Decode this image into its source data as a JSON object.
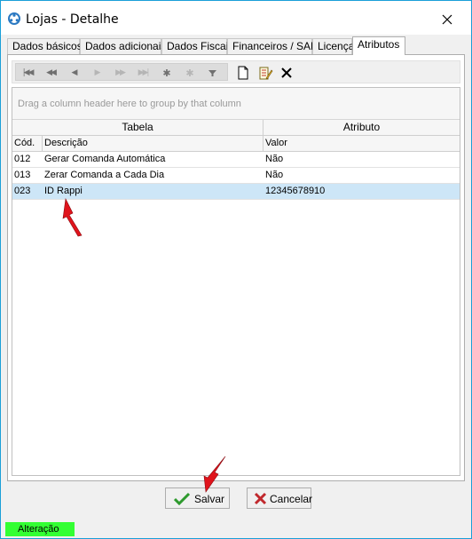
{
  "window": {
    "title": "Lojas - Detalhe"
  },
  "tabs": [
    {
      "label": "Dados básicos"
    },
    {
      "label": "Dados adicionais"
    },
    {
      "label": "Dados Fiscais"
    },
    {
      "label": "Financeiros / SAP"
    },
    {
      "label": "Licença"
    },
    {
      "label": "Atributos",
      "active": true
    }
  ],
  "toolbar": {
    "nav_buttons": [
      "first",
      "prior-page",
      "prior",
      "next",
      "next-page",
      "last",
      "insert",
      "delete",
      "filter"
    ],
    "extra_buttons": [
      "new-document-icon",
      "edit-document-icon",
      "delete-x-icon"
    ]
  },
  "grid": {
    "group_hint": "Drag a column header here to group by that column",
    "bands": [
      "Tabela",
      "Atributo"
    ],
    "columns": [
      "Cód.",
      "Descrição",
      "Valor"
    ],
    "rows": [
      {
        "cod": "012",
        "descricao": "Gerar Comanda Automática",
        "valor": "Não"
      },
      {
        "cod": "013",
        "descricao": "Zerar Comanda a Cada Dia",
        "valor": "Não"
      },
      {
        "cod": "023",
        "descricao": "ID Rappi",
        "valor": "12345678910",
        "selected": true
      }
    ]
  },
  "buttons": {
    "save_label": "Salvar",
    "cancel_label": "Cancelar"
  },
  "status": {
    "text": "Alteração",
    "color": "#33ff33"
  },
  "colors": {
    "selected_row": "#cde6f7",
    "window_border": "#1a9fd8",
    "annotation_arrow": "#e0141c"
  }
}
